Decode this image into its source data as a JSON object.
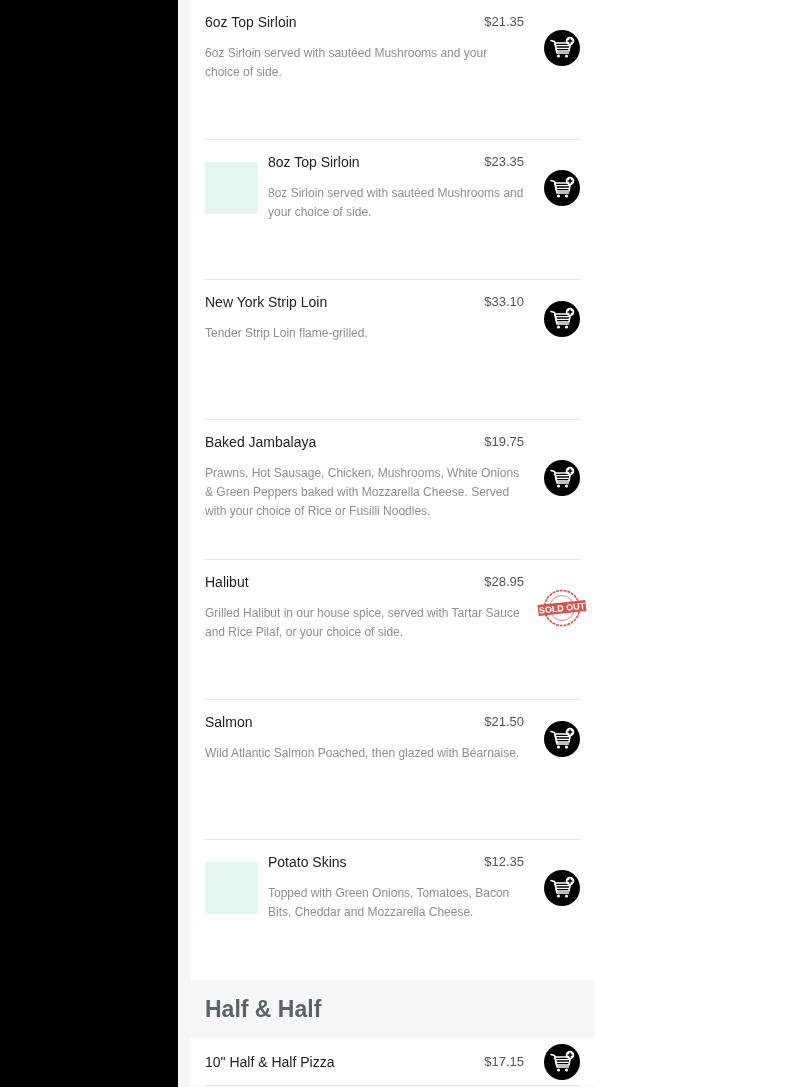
{
  "sections": [
    {
      "items": [
        {
          "name": "6oz Top Sirloin",
          "price": "$21.35",
          "description": "6oz Sirloin served with sautéed Mushrooms and your choice of side.",
          "has_photo": false,
          "kind": "add_to_cart"
        },
        {
          "name": "8oz Top Sirloin",
          "price": "$23.35",
          "description": "8oz Sirloin served with sautéed Mushrooms and your choice of side.",
          "has_photo": true,
          "kind": "add_to_cart"
        },
        {
          "name": "New York Strip Loin",
          "price": "$33.10",
          "description": "Tender Strip Loin flame-grilled.",
          "has_photo": false,
          "kind": "add_to_cart"
        },
        {
          "name": "Baked Jambalaya",
          "price": "$19.75",
          "description": "Prawns, Hot Sausage, Chicken, Mushrooms, White Onions & Green Peppers baked with Mozzarella Cheese. Served with your choice of Rice or Fusilli Noodles.",
          "has_photo": false,
          "kind": "add_to_cart"
        },
        {
          "name": "Halibut",
          "price": "$28.95",
          "description": "Grilled Halibut in our house spice, served with Tartar Sauce and Rice Pilaf, or your choice of side.",
          "has_photo": false,
          "kind": "sold_out",
          "badge": "SOLD OUT"
        },
        {
          "name": "Salmon",
          "price": "$21.50",
          "description": "Wild Atlantic Salmon Poached, then glazed with Béarnaise.",
          "has_photo": false,
          "kind": "add_to_cart"
        },
        {
          "name": "Potato Skins",
          "price": "$12.35",
          "description": "Topped with Green Onions, Tomatoes, Bacon Bits, Cheddar and Mozzarella Cheese.",
          "has_photo": true,
          "kind": "add_to_cart"
        }
      ]
    },
    {
      "title": "Half & Half",
      "items": [
        {
          "name": "10\" Half & Half Pizza",
          "price": "$17.15",
          "has_photo": false,
          "kind": "add_to_cart"
        }
      ]
    }
  ]
}
